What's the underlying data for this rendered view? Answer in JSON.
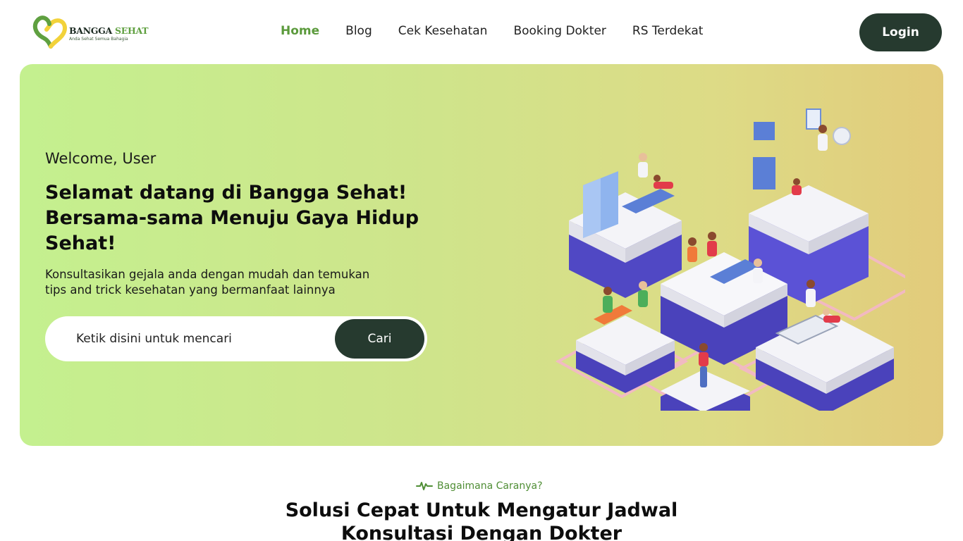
{
  "brand": {
    "name_part1": "BANGGA",
    "name_part2": "SEHAT",
    "tagline": "Anda Sehat Semua Bahagia",
    "colors": {
      "green": "#5fa040",
      "yellow": "#f2d23a",
      "dark": "#263a2f"
    }
  },
  "nav": {
    "items": [
      {
        "label": "Home",
        "active": true
      },
      {
        "label": "Blog",
        "active": false
      },
      {
        "label": "Cek Kesehatan",
        "active": false
      },
      {
        "label": "Booking Dokter",
        "active": false
      },
      {
        "label": "RS Terdekat",
        "active": false
      }
    ],
    "login_label": "Login"
  },
  "hero": {
    "welcome": "Welcome, User",
    "title_lines": [
      "Selamat datang di Bangga Sehat!",
      "Bersama-sama Menuju Gaya Hidup",
      "Sehat!"
    ],
    "subtitle_lines": [
      "Konsultasikan gejala anda dengan mudah dan temukan",
      "tips and trick kesehatan yang bermanfaat lainnya"
    ],
    "search": {
      "placeholder": "Ketik disini untuk mencari",
      "button_label": "Cari"
    }
  },
  "how": {
    "tag_icon": "heartbeat-icon",
    "tag": "Bagaimana Caranya?",
    "title_lines": [
      "Solusi Cepat Untuk Mengatur Jadwal",
      "Konsultasi Dengan Dokter"
    ]
  }
}
